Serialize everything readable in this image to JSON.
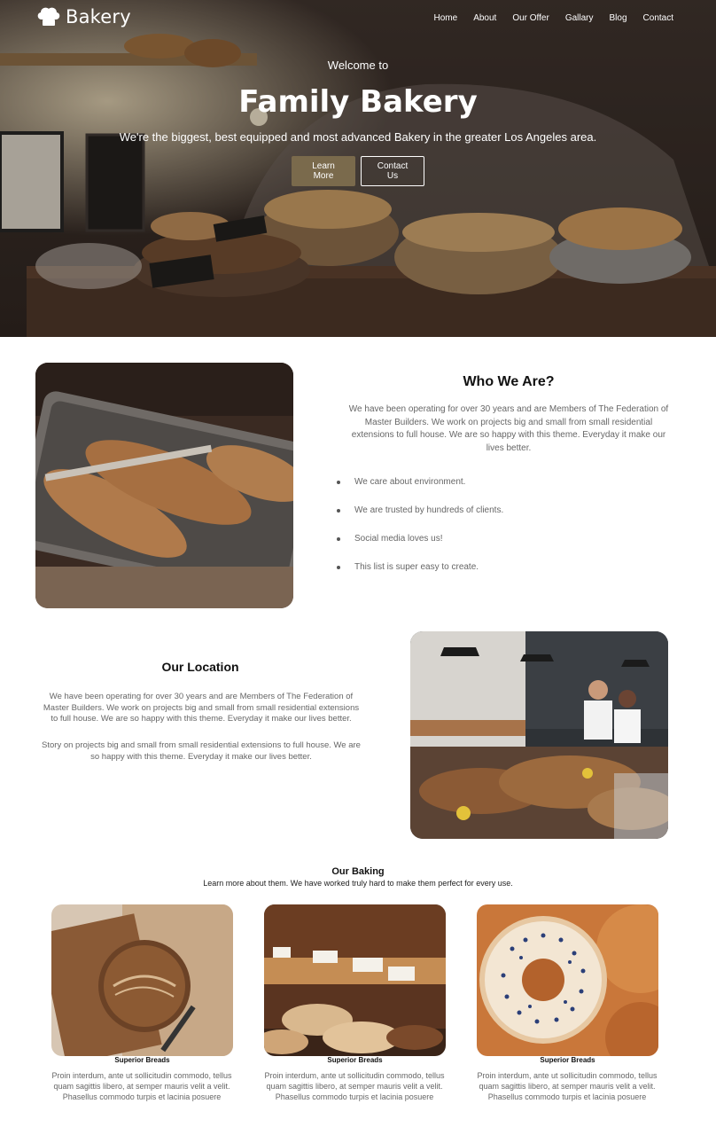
{
  "brand": {
    "name": "Bakery",
    "logo_icon": "chef-hat-icon"
  },
  "nav": {
    "items": [
      {
        "label": "Home"
      },
      {
        "label": "About"
      },
      {
        "label": "Our Offer"
      },
      {
        "label": "Gallary"
      },
      {
        "label": "Blog"
      },
      {
        "label": "Contact"
      }
    ]
  },
  "hero": {
    "welcome": "Welcome to",
    "title": "Family Bakery",
    "subtitle": "We're the biggest, best equipped and most advanced Bakery in the greater Los Angeles area.",
    "primary_button": "Learn More",
    "secondary_button": "Contact Us"
  },
  "who": {
    "title": "Who We Are?",
    "text": "We have been operating for over 30 years and are Members of The Federation of Master Builders. We work on projects big and small from small residential extensions to full house. We are so happy with this theme. Everyday it make our lives better.",
    "list": [
      "We care about environment.",
      "We are trusted by hundreds of clients.",
      "Social media loves us!",
      "This list is super easy to create."
    ]
  },
  "location": {
    "title": "Our Location",
    "text1": "We have been operating for over 30 years and are Members of The Federation of Master Builders. We work on projects big and small from small residential extensions to full house. We are so happy with this theme. Everyday it make our lives better.",
    "text2": "Story on projects big and small from small residential extensions to full house. We are so happy with this theme. Everyday it make our lives better."
  },
  "baking": {
    "title": "Our Baking",
    "subtitle": "Learn more about them. We have worked truly hard to make them perfect for every use.",
    "cards": [
      {
        "name": "Superior Breads",
        "text": "Proin interdum, ante ut sollicitudin commodo, tellus quam sagittis libero, at semper mauris velit a velit. Phasellus commodo turpis et lacinia posuere"
      },
      {
        "name": "Superior Breads",
        "text": "Proin interdum, ante ut sollicitudin commodo, tellus quam sagittis libero, at semper mauris velit a velit. Phasellus commodo turpis et lacinia posuere"
      },
      {
        "name": "Superior Breads",
        "text": "Proin interdum, ante ut sollicitudin commodo, tellus quam sagittis libero, at semper mauris velit a velit. Phasellus commodo turpis et lacinia posuere"
      }
    ]
  },
  "colors": {
    "accent": "#7a6a4c",
    "text_muted": "#666666",
    "heading": "#111111"
  }
}
